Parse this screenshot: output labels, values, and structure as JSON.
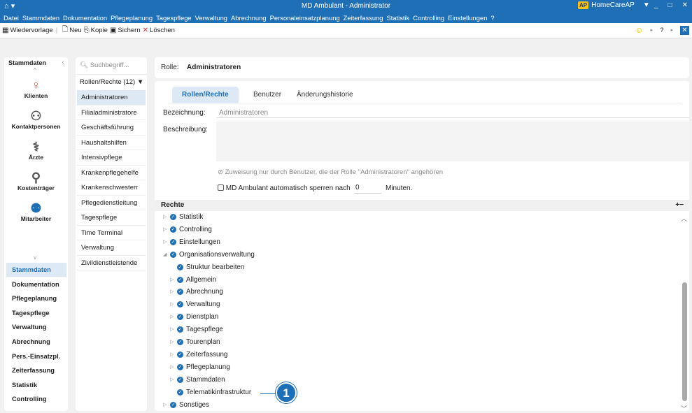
{
  "window": {
    "title": "MD Ambulant - Administrator",
    "brand_badge": "AP",
    "brand": "HomeCareAP",
    "filter_icon": "filter-icon"
  },
  "menu": [
    "Datei",
    "Stammdaten",
    "Dokumentation",
    "Pflegeplanung",
    "Tagespflege",
    "Verwaltung",
    "Abrechnung",
    "Personaleinsatzplanung",
    "Zeiterfassung",
    "Statistik",
    "Controlling",
    "Einstellungen",
    "?"
  ],
  "toolbar": {
    "wiedervorlage": "Wiedervorlage",
    "neu": "Neu",
    "kopie": "Kopie",
    "sichern": "Sichern",
    "loeschen": "Löschen"
  },
  "nav": {
    "header": "Stammdaten",
    "icons": [
      {
        "label": "Klienten",
        "icon": "person-icon",
        "color": "#e05a4f"
      },
      {
        "label": "Kontaktpersonen",
        "icon": "contacts-icon",
        "color": "#555"
      },
      {
        "label": "Ärzte",
        "icon": "doctor-icon",
        "color": "#555"
      },
      {
        "label": "Kostenträger",
        "icon": "payer-icon",
        "color": "#555"
      },
      {
        "label": "Mitarbeiter",
        "icon": "employee-icon",
        "color": "#1f6fb6"
      }
    ],
    "items": [
      "Stammdaten",
      "Dokumentation",
      "Pflegeplanung",
      "Tagespflege",
      "Verwaltung",
      "Abrechnung",
      "Pers.-Einsatzpl.",
      "Zeiterfassung",
      "Statistik",
      "Controlling"
    ]
  },
  "list": {
    "search_placeholder": "Suchbegriff...",
    "count_label": "Rollen/Rechte (12)",
    "roles": [
      "Administratoren",
      "Filialadministratore",
      "Geschäftsführung",
      "Haushaltshilfen",
      "Intensivpflege",
      "Krankenpflegehelfe",
      "Krankenschwesterr",
      "Pflegedienstleitung",
      "Tagespflege",
      "Time Terminal",
      "Verwaltung",
      "Zivildienstleistende"
    ]
  },
  "role": {
    "label": "Rolle:",
    "name": "Administratoren"
  },
  "tabs": [
    "Rollen/Rechte",
    "Benutzer",
    "Änderungshistorie"
  ],
  "form": {
    "bezeichnung_label": "Bezeichnung:",
    "bezeichnung_value": "Administratoren",
    "beschreibung_label": "Beschreibung:",
    "zuweisung_text": "Zuweisung nur durch Benutzer, die der Rolle \"Administratoren\" angehören",
    "sperren_prefix": "MD Ambulant automatisch sperren nach",
    "sperren_value": "0",
    "sperren_suffix": "Minuten."
  },
  "rechte": {
    "header": "Rechte",
    "plusminus": "+−",
    "tree": [
      {
        "label": "Statistik",
        "level": 0,
        "arrow": "▷"
      },
      {
        "label": "Controlling",
        "level": 0,
        "arrow": "▷"
      },
      {
        "label": "Einstellungen",
        "level": 0,
        "arrow": "▷"
      },
      {
        "label": "Organisationsverwaltung",
        "level": 0,
        "arrow": "◢"
      },
      {
        "label": "Struktur bearbeiten",
        "level": 1,
        "arrow": ""
      },
      {
        "label": "Allgemein",
        "level": 1,
        "arrow": "▷"
      },
      {
        "label": "Abrechnung",
        "level": 1,
        "arrow": "▷"
      },
      {
        "label": "Verwaltung",
        "level": 1,
        "arrow": "▷"
      },
      {
        "label": "Dienstplan",
        "level": 1,
        "arrow": "▷"
      },
      {
        "label": "Tagespflege",
        "level": 1,
        "arrow": "▷"
      },
      {
        "label": "Tourenplan",
        "level": 1,
        "arrow": "▷"
      },
      {
        "label": "Zeiterfassung",
        "level": 1,
        "arrow": "▷"
      },
      {
        "label": "Pflegeplanung",
        "level": 1,
        "arrow": "▷"
      },
      {
        "label": "Stammdaten",
        "level": 1,
        "arrow": "▷"
      },
      {
        "label": "Telematikinfrastruktur",
        "level": 1,
        "arrow": ""
      },
      {
        "label": "Sonstiges",
        "level": 0,
        "arrow": "▷"
      }
    ]
  },
  "callout": "1"
}
